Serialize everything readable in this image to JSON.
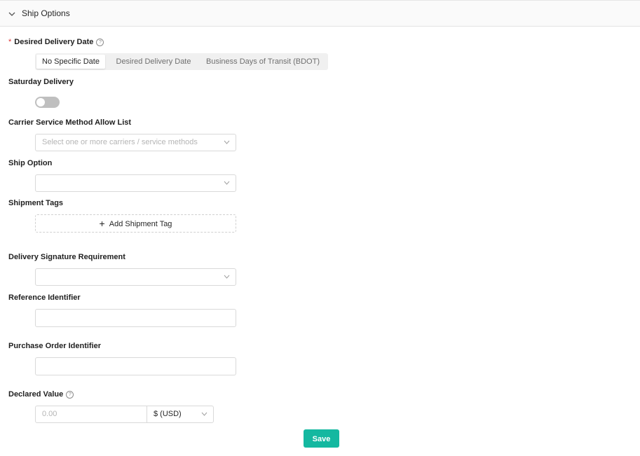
{
  "header": {
    "title": "Ship Options"
  },
  "desired_delivery": {
    "required_mark": "*",
    "label": "Desired Delivery Date",
    "help_glyph": "?",
    "options": [
      "No Specific Date",
      "Desired Delivery Date",
      "Business Days of Transit (BDOT)"
    ],
    "selected": "No Specific Date"
  },
  "saturday_delivery": {
    "label": "Saturday Delivery",
    "enabled": false
  },
  "carrier_allow_list": {
    "label": "Carrier Service Method Allow List",
    "placeholder": "Select one or more carriers / service methods"
  },
  "ship_option": {
    "label": "Ship Option",
    "value": ""
  },
  "shipment_tags": {
    "label": "Shipment Tags",
    "add_glyph": "+",
    "add_label": "Add Shipment Tag"
  },
  "signature": {
    "label": "Delivery Signature Requirement",
    "value": ""
  },
  "reference_identifier": {
    "label": "Reference Identifier",
    "value": ""
  },
  "purchase_order": {
    "label": "Purchase Order Identifier",
    "value": ""
  },
  "declared_value": {
    "label": "Declared Value",
    "help_glyph": "?",
    "placeholder": "0.00",
    "currency": "$ (USD)"
  },
  "save_label": "Save",
  "colors": {
    "primary": "#14b8a0",
    "required": "#e03131"
  }
}
